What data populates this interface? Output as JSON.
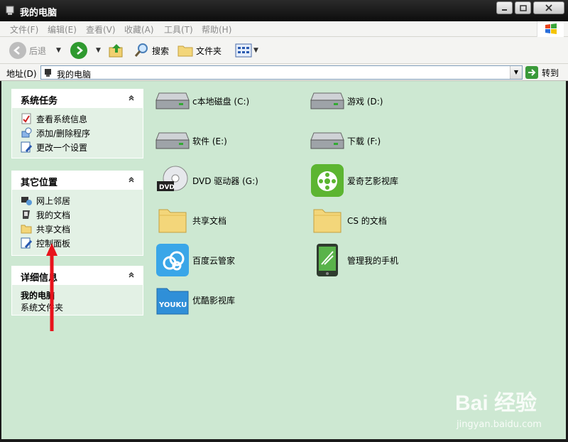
{
  "window": {
    "title": "我的电脑"
  },
  "menu": [
    "文件(F)",
    "编辑(E)",
    "查看(V)",
    "收藏(A)",
    "工具(T)",
    "帮助(H)"
  ],
  "toolbar": {
    "back": "后退",
    "search": "搜索",
    "folders": "文件夹"
  },
  "address": {
    "label": "地址(D)",
    "value": "我的电脑",
    "go": "转到"
  },
  "panels": {
    "system_tasks": {
      "title": "系统任务",
      "links": [
        "查看系统信息",
        "添加/删除程序",
        "更改一个设置"
      ]
    },
    "other_places": {
      "title": "其它位置",
      "links": [
        "网上邻居",
        "我的文档",
        "共享文档",
        "控制面板"
      ]
    },
    "details": {
      "title": "详细信息",
      "name": "我的电脑",
      "type": "系统文件夹"
    }
  },
  "items": [
    {
      "name": "c本地磁盘 (C:)",
      "icon": "hard-drive-icon"
    },
    {
      "name": "游戏 (D:)",
      "icon": "hard-drive-icon"
    },
    {
      "name": "软件 (E:)",
      "icon": "hard-drive-icon"
    },
    {
      "name": "下载 (F:)",
      "icon": "hard-drive-icon"
    },
    {
      "name": "DVD 驱动器 (G:)",
      "icon": "dvd-drive-icon"
    },
    {
      "name": "爱奇艺影视库",
      "icon": "iqiyi-icon"
    },
    {
      "name": "共享文档",
      "icon": "folder-icon"
    },
    {
      "name": "CS 的文档",
      "icon": "folder-icon"
    },
    {
      "name": "百度云管家",
      "icon": "baidu-cloud-icon"
    },
    {
      "name": "管理我的手机",
      "icon": "phone-manager-icon"
    },
    {
      "name": "优酷影视库",
      "icon": "youku-icon"
    }
  ],
  "icon_labels": {
    "dvd": "DVD",
    "youku": "YOUKU"
  },
  "watermark": {
    "main": "Bai 经验",
    "sub": "jingyan.baidu.com"
  },
  "colors": {
    "background": "#cde8d2",
    "panel": "#e3f1e5",
    "arrow": "#e8141c"
  }
}
